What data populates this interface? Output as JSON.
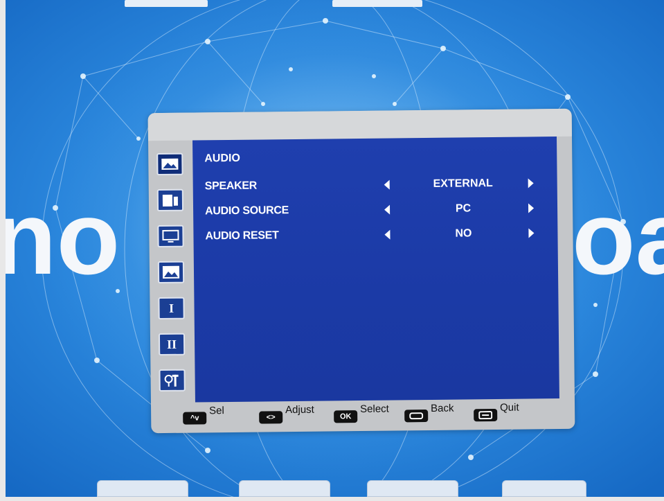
{
  "background": {
    "brand_text_left": "no",
    "brand_text_right": "oa",
    "colors": {
      "sky": "#1f7fd6",
      "glow": "#bfe6ff"
    }
  },
  "osd": {
    "sidebar": [
      {
        "icon": "picture-icon",
        "glyph": ""
      },
      {
        "icon": "audio-icon",
        "glyph": ""
      },
      {
        "icon": "display-icon",
        "glyph": ""
      },
      {
        "icon": "pip-icon",
        "glyph": ""
      },
      {
        "icon": "setup-one-icon",
        "glyph": "I"
      },
      {
        "icon": "setup-two-icon",
        "glyph": "II"
      },
      {
        "icon": "tools-icon",
        "glyph": ""
      }
    ],
    "title": "AUDIO",
    "rows": [
      {
        "label": "SPEAKER",
        "value": "EXTERNAL"
      },
      {
        "label": "AUDIO SOURCE",
        "value": "PC"
      },
      {
        "label": "AUDIO RESET",
        "value": "NO"
      }
    ],
    "footer": [
      {
        "key": "^v",
        "label": "Sel"
      },
      {
        "key": "<>",
        "label": "Adjust"
      },
      {
        "key": "OK",
        "label": "Select"
      },
      {
        "key": "",
        "label": "Back"
      },
      {
        "key": "",
        "label": "Quit"
      }
    ],
    "colors": {
      "panel": "#1d3ca8",
      "frame": "#c4c6c9",
      "text": "#ffffff"
    }
  }
}
